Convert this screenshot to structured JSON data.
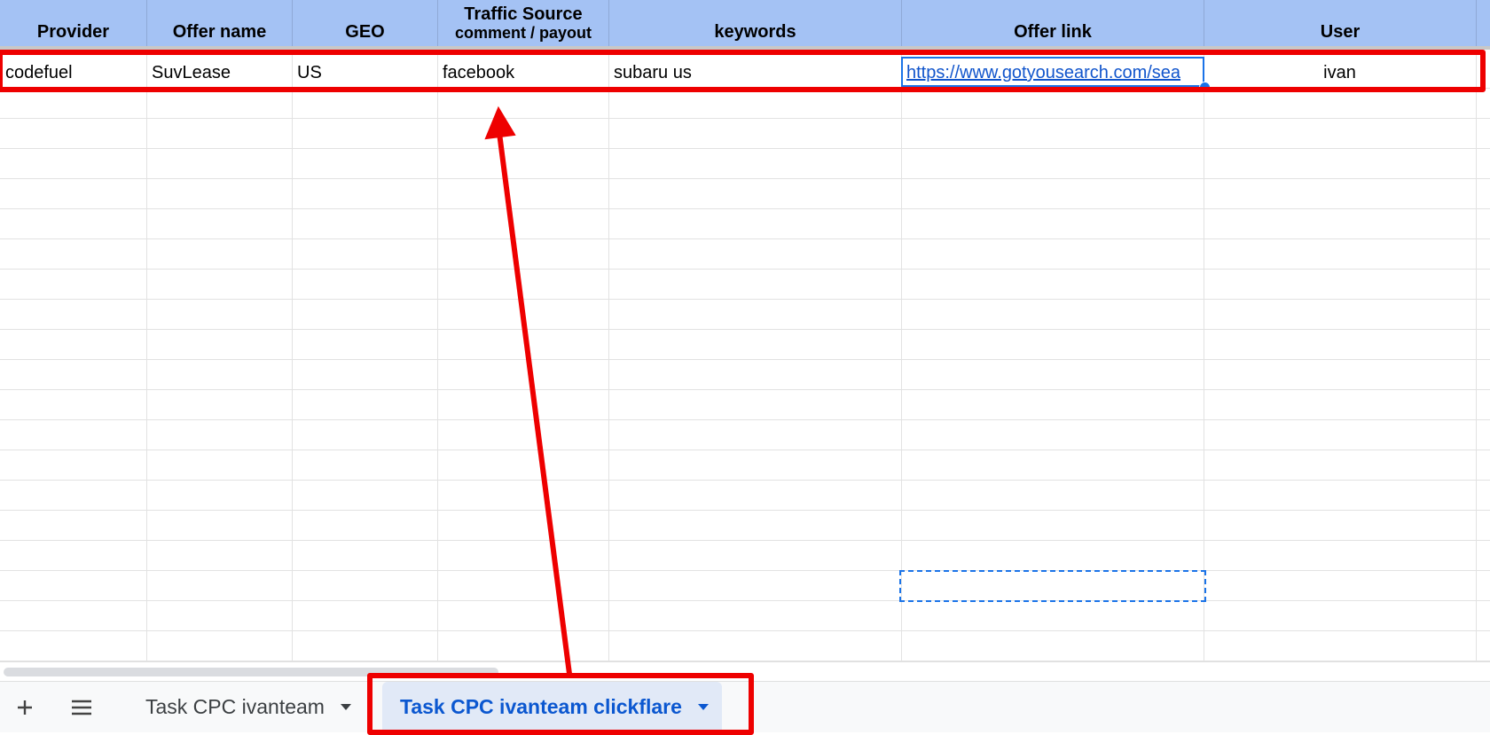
{
  "headers": [
    {
      "label": "Provider",
      "sub": ""
    },
    {
      "label": "Offer name",
      "sub": ""
    },
    {
      "label": "GEO",
      "sub": ""
    },
    {
      "label": "Traffic Source",
      "sub": "comment / payout"
    },
    {
      "label": "keywords",
      "sub": ""
    },
    {
      "label": "Offer link",
      "sub": ""
    },
    {
      "label": "User",
      "sub": ""
    }
  ],
  "row": {
    "provider": "codefuel",
    "offer_name": "SuvLease",
    "geo": "US",
    "traffic_source": "facebook",
    "keywords": "subaru us",
    "offer_link": "https://www.gotyousearch.com/sea",
    "user": "ivan"
  },
  "tabs": {
    "add_icon": "plus-icon",
    "menu_icon": "hamburger-menu-icon",
    "items": [
      {
        "label": "Task CPC ivanteam",
        "active": false
      },
      {
        "label": "Task CPC ivanteam clickflare",
        "active": true
      }
    ]
  },
  "colors": {
    "header_bg": "#a4c2f4",
    "link": "#1155cc",
    "selection": "#1a73e8",
    "annotation": "#ee0000",
    "active_tab_bg": "#e1e9f7",
    "active_tab_text": "#0b57d0"
  }
}
